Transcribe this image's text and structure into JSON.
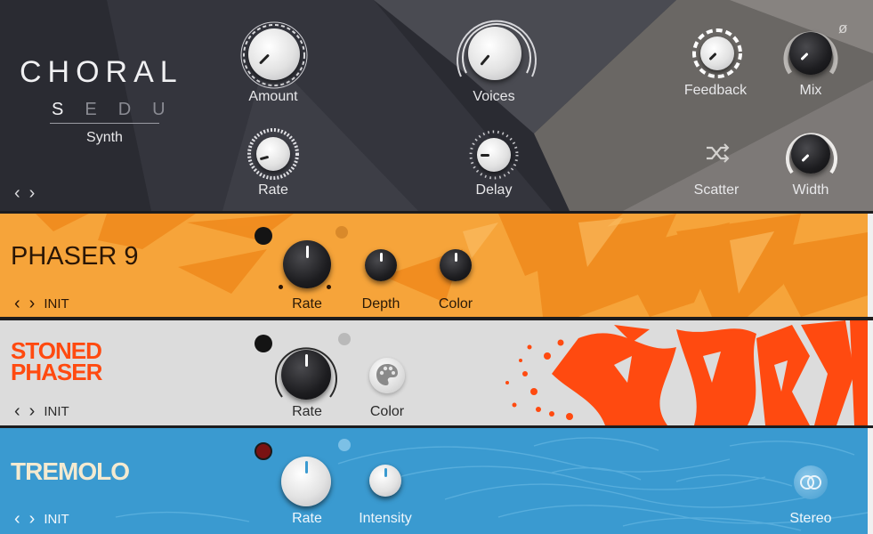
{
  "choral": {
    "brand": "CHORAL",
    "modes": [
      "S",
      "E",
      "D",
      "U"
    ],
    "preset_type": "Synth",
    "knobs": {
      "amount": "Amount",
      "voices": "Voices",
      "feedback": "Feedback",
      "mix": "Mix",
      "rate": "Rate",
      "delay": "Delay",
      "scatter": "Scatter",
      "width": "Width"
    },
    "phase_symbol": "ø"
  },
  "phaser9": {
    "title": "PHASER 9",
    "preset": "INIT",
    "knobs": {
      "rate": "Rate",
      "depth": "Depth",
      "color": "Color"
    }
  },
  "stoned": {
    "title_line1": "STONED",
    "title_line2": "PHASER",
    "preset": "INIT",
    "knobs": {
      "rate": "Rate",
      "color": "Color"
    }
  },
  "tremolo": {
    "title": "TREMOLO",
    "preset": "INIT",
    "knobs": {
      "rate": "Rate",
      "intensity": "Intensity",
      "stereo": "Stereo"
    }
  },
  "colors": {
    "choral_bg": "#2a2b32",
    "phaser9_bg": "#f6a43a",
    "stoned_bg": "#dcdcdc",
    "stoned_accent": "#ff4a10",
    "tremolo_bg": "#3a9ad0",
    "tremolo_title": "#f4ead0"
  },
  "icons": {
    "nav_prev": "‹",
    "nav_next": "›"
  }
}
